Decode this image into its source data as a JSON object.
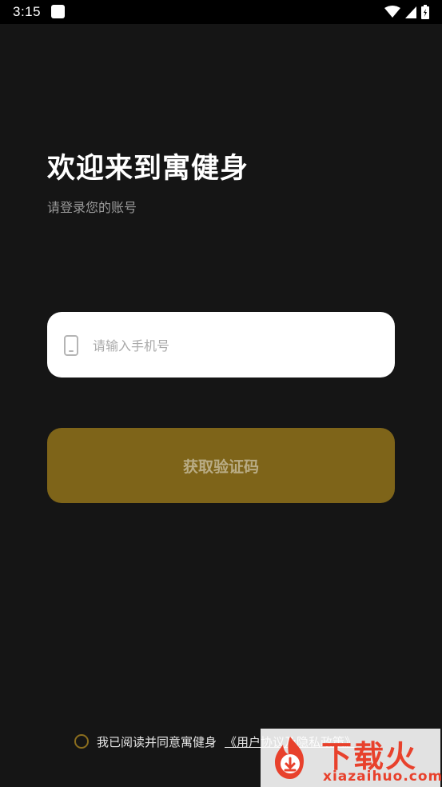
{
  "status_bar": {
    "time": "3:15",
    "icons": [
      "app-notification-icon",
      "wifi-icon",
      "signal-icon",
      "battery-icon"
    ]
  },
  "welcome": {
    "title": "欢迎来到寓健身",
    "subtitle": "请登录您的账号"
  },
  "phone_field": {
    "icon": "phone-icon",
    "placeholder": "请输入手机号",
    "value": ""
  },
  "get_code_button": {
    "label": "获取验证码"
  },
  "agreement": {
    "checked": false,
    "text": "我已阅读并同意寓健身",
    "link": "《用户协议及隐私政策》"
  },
  "watermark": {
    "title": "下载火",
    "domain": "xiazaihuo.com"
  },
  "colors": {
    "background": "#151515",
    "button": "#7e6419",
    "button_text": "#b9ac85",
    "accent": "#8a6d1e",
    "watermark": "#e8412c"
  }
}
